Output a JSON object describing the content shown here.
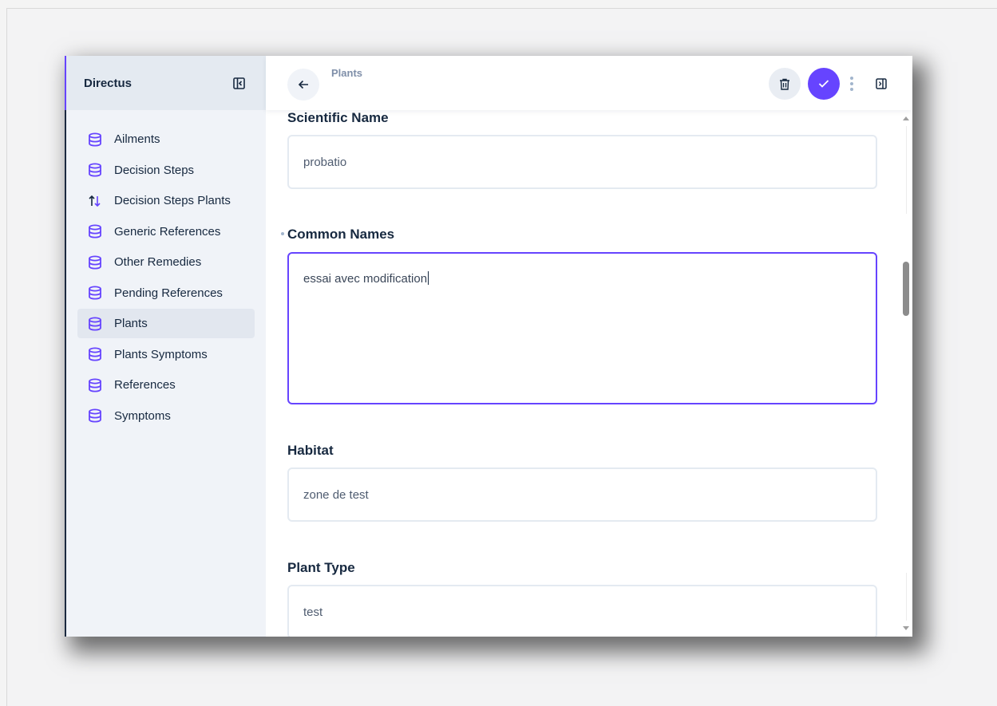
{
  "app": {
    "name": "Directus"
  },
  "sidebar": {
    "items": [
      {
        "label": "Ailments",
        "icon": "database-icon"
      },
      {
        "label": "Decision Steps",
        "icon": "database-icon"
      },
      {
        "label": "Decision Steps Plants",
        "icon": "relation-arrows-icon"
      },
      {
        "label": "Generic References",
        "icon": "database-icon"
      },
      {
        "label": "Other Remedies",
        "icon": "database-icon"
      },
      {
        "label": "Pending References",
        "icon": "database-icon"
      },
      {
        "label": "Plants",
        "icon": "database-icon",
        "active": true
      },
      {
        "label": "Plants Symptoms",
        "icon": "database-icon"
      },
      {
        "label": "References",
        "icon": "database-icon"
      },
      {
        "label": "Symptoms",
        "icon": "database-icon"
      }
    ]
  },
  "header": {
    "breadcrumb": "Plants"
  },
  "form": {
    "scientific_name": {
      "label": "Scientific Name",
      "value": "probatio"
    },
    "common_names": {
      "label": "Common Names",
      "value": "essai avec modification"
    },
    "habitat": {
      "label": "Habitat",
      "value": "zone de test"
    },
    "plant_type": {
      "label": "Plant Type",
      "value": "test"
    }
  },
  "colors": {
    "accent": "#6644ff",
    "sidebar_bg": "#f0f3f8",
    "text": "#172940"
  }
}
